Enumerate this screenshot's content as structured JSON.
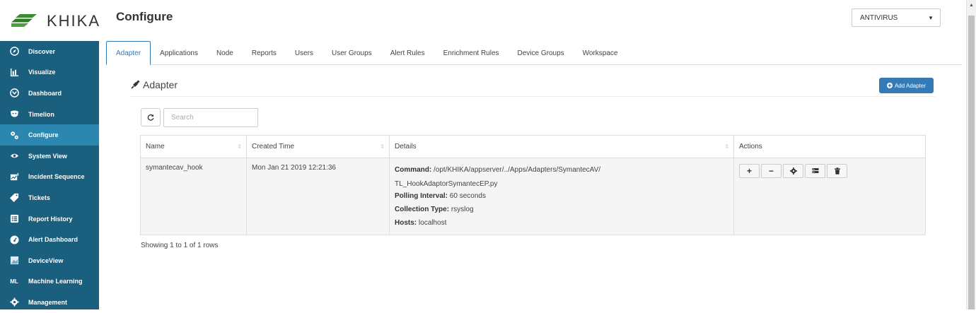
{
  "brand": {
    "name": "KHIKA"
  },
  "sidebar": {
    "items": [
      {
        "label": "Discover",
        "icon": "compass-icon"
      },
      {
        "label": "Visualize",
        "icon": "bar-chart-icon"
      },
      {
        "label": "Dashboard",
        "icon": "dashboard-icon"
      },
      {
        "label": "Timelion",
        "icon": "shield-icon"
      },
      {
        "label": "Configure",
        "icon": "cogs-icon",
        "active": true
      },
      {
        "label": "System View",
        "icon": "eye-icon"
      },
      {
        "label": "Incident Sequence",
        "icon": "chart-doc-icon"
      },
      {
        "label": "Tickets",
        "icon": "tag-icon"
      },
      {
        "label": "Report History",
        "icon": "list-icon"
      },
      {
        "label": "Alert Dashboard",
        "icon": "gauge-icon"
      },
      {
        "label": "DeviceView",
        "icon": "image-icon"
      },
      {
        "label": "Machine Learning",
        "icon_text": "ML"
      },
      {
        "label": "Management",
        "icon": "gear-icon"
      }
    ]
  },
  "header": {
    "title": "Configure",
    "device_select": {
      "value": "ANTIVIRUS"
    }
  },
  "tabs": [
    {
      "label": "Adapter",
      "active": true
    },
    {
      "label": "Applications"
    },
    {
      "label": "Node"
    },
    {
      "label": "Reports"
    },
    {
      "label": "Users"
    },
    {
      "label": "User Groups"
    },
    {
      "label": "Alert Rules"
    },
    {
      "label": "Enrichment Rules"
    },
    {
      "label": "Device Groups"
    },
    {
      "label": "Workspace"
    }
  ],
  "section": {
    "title": "Adapter",
    "add_button": "Add Adapter"
  },
  "toolbar": {
    "search_placeholder": "Search"
  },
  "table": {
    "columns": [
      "Name",
      "Created Time",
      "Details",
      "Actions"
    ],
    "rows": [
      {
        "name": "symantecav_hook",
        "created": "Mon Jan 21 2019 12:21:36",
        "details": {
          "command_label": "Command:",
          "command_value": "/opt/KHIKA/appserver/../Apps/Adapters/SymantecAV/",
          "command_cont": "TL_HookAdaptorSymantecEP.py",
          "polling_label": "Polling Interval:",
          "polling_value": "60 seconds",
          "collection_label": "Collection Type:",
          "collection_value": "rsyslog",
          "hosts_label": "Hosts:",
          "hosts_value": "localhost"
        }
      }
    ]
  },
  "footer": {
    "text": "Showing 1 to 1 of 1 rows"
  },
  "colors": {
    "sidebar_bg": "#1b5f7e",
    "sidebar_active": "#2b86b0",
    "primary": "#337ab7",
    "logo_green": "#3a8d2f"
  }
}
